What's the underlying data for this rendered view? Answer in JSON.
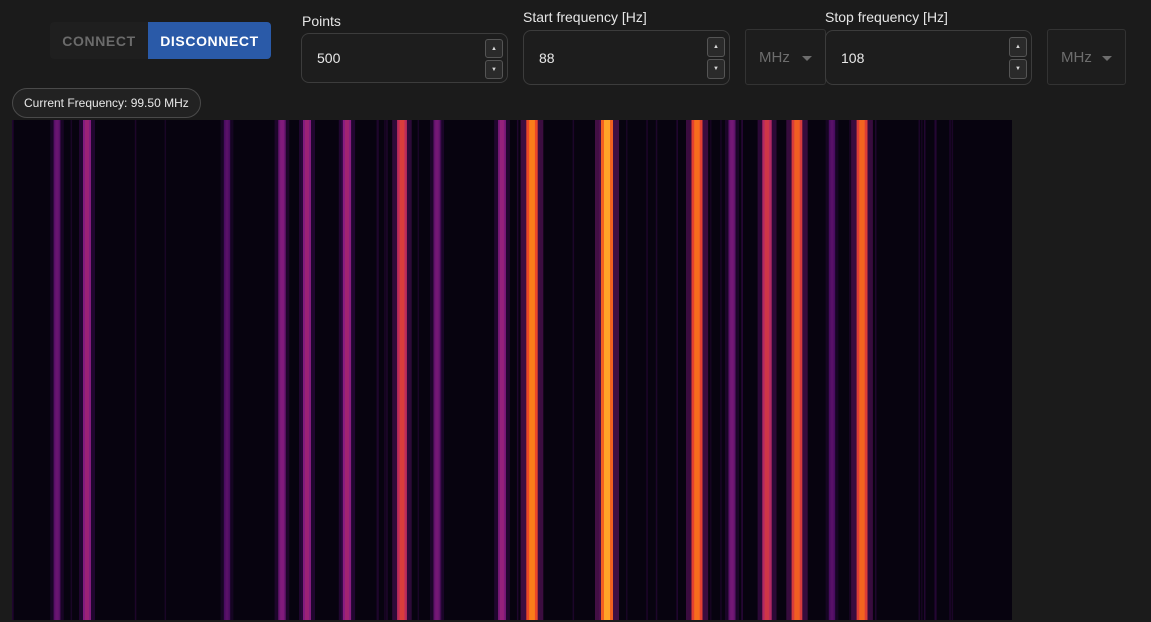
{
  "controls": {
    "connect_label": "CONNECT",
    "disconnect_label": "DISCONNECT"
  },
  "points": {
    "label": "Points",
    "value": "500"
  },
  "start_frequency": {
    "label": "Start frequency [Hz]",
    "value": "88",
    "unit": "MHz"
  },
  "stop_frequency": {
    "label": "Stop frequency [Hz]",
    "value": "108",
    "unit": "MHz"
  },
  "stepper": {
    "up_glyph": "▲",
    "down_glyph": "▼",
    "caret_icon": "chevron-down-icon"
  },
  "status": {
    "current_frequency": "Current Frequency: 99.50 MHz"
  },
  "colors": {
    "disconnect_accent": "#2a5aa8",
    "waterfall_background": "#07030f"
  },
  "waterfall": {
    "frequency_range_mhz": [
      88,
      108
    ],
    "signals": [
      {
        "freq_mhz": 88.9,
        "intensity": 0.35
      },
      {
        "freq_mhz": 89.5,
        "intensity": 0.5
      },
      {
        "freq_mhz": 92.3,
        "intensity": 0.3
      },
      {
        "freq_mhz": 93.4,
        "intensity": 0.42
      },
      {
        "freq_mhz": 93.9,
        "intensity": 0.5
      },
      {
        "freq_mhz": 94.7,
        "intensity": 0.52
      },
      {
        "freq_mhz": 95.8,
        "intensity": 0.72
      },
      {
        "freq_mhz": 96.5,
        "intensity": 0.38
      },
      {
        "freq_mhz": 97.8,
        "intensity": 0.48
      },
      {
        "freq_mhz": 98.4,
        "intensity": 0.92
      },
      {
        "freq_mhz": 99.9,
        "intensity": 1.0
      },
      {
        "freq_mhz": 101.7,
        "intensity": 0.88
      },
      {
        "freq_mhz": 102.4,
        "intensity": 0.38
      },
      {
        "freq_mhz": 103.1,
        "intensity": 0.68
      },
      {
        "freq_mhz": 103.7,
        "intensity": 0.84
      },
      {
        "freq_mhz": 104.4,
        "intensity": 0.3
      },
      {
        "freq_mhz": 105.0,
        "intensity": 0.86
      }
    ]
  }
}
